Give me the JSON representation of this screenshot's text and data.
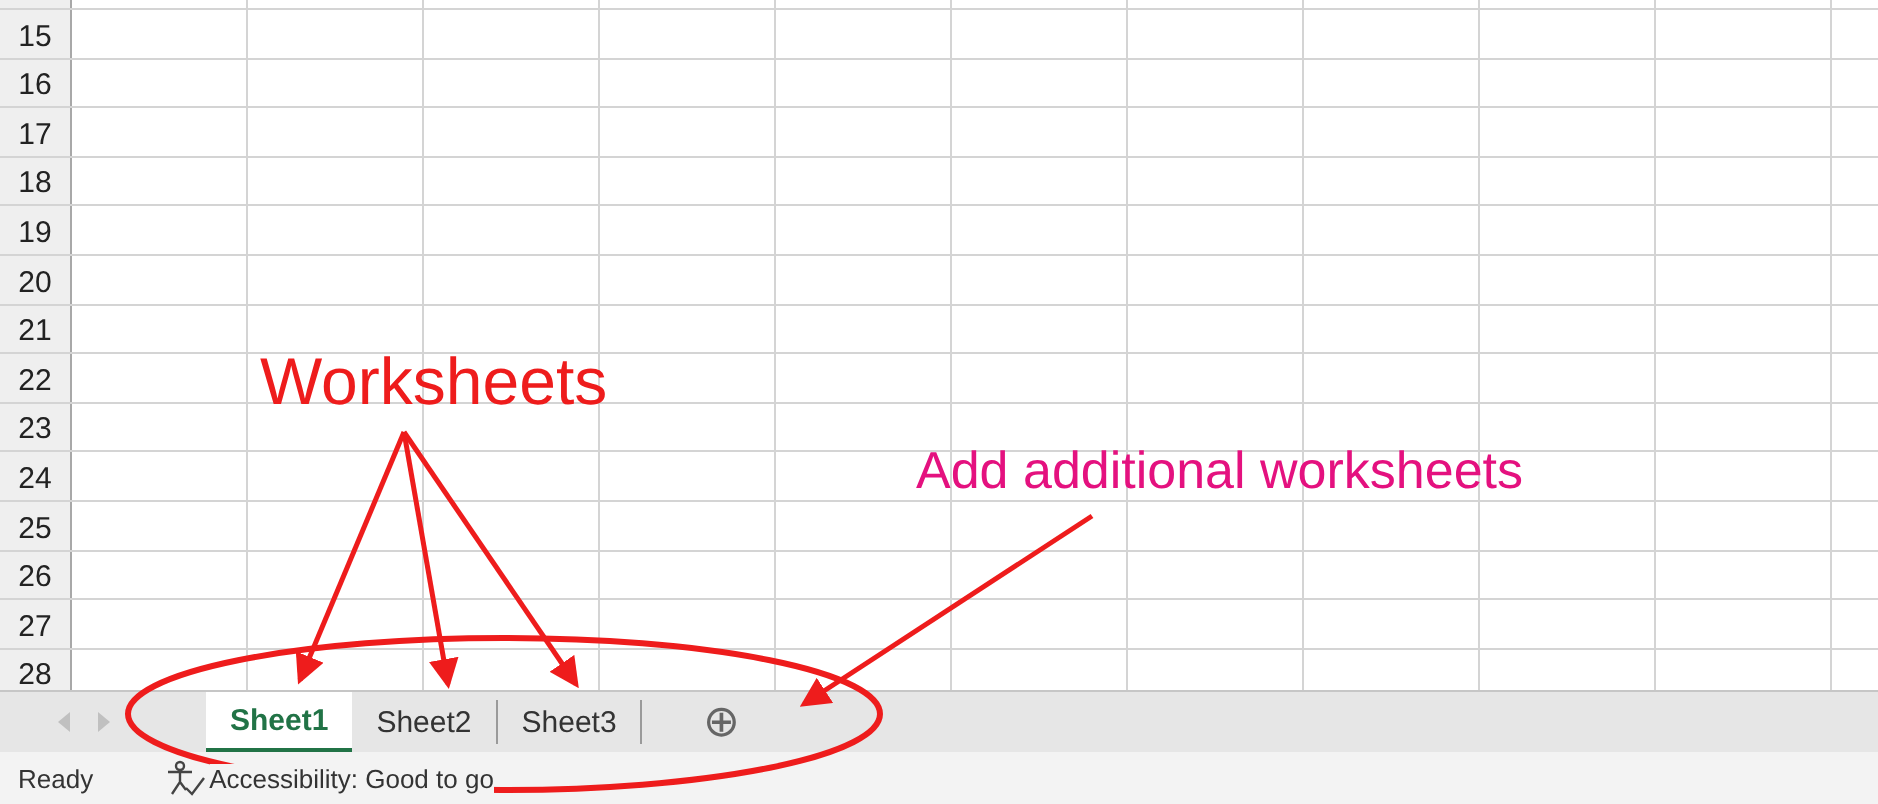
{
  "row_headers": [
    "15",
    "16",
    "17",
    "18",
    "19",
    "20",
    "21",
    "22",
    "23",
    "24",
    "25",
    "26",
    "27",
    "28"
  ],
  "sheet_nav": [
    {
      "kind": "left",
      "disabled": true
    },
    {
      "kind": "right",
      "disabled": true
    }
  ],
  "sheet_tabs": [
    {
      "label": "Sheet1",
      "selected": true
    },
    {
      "label": "Sheet2",
      "selected": false
    },
    {
      "label": "Sheet3",
      "selected": false
    }
  ],
  "add_sheet": {
    "icon": "⊕"
  },
  "status_bar": {
    "mode": "Ready",
    "accessibility": "Accessibility: Good to go"
  },
  "annotations": [
    {
      "kind": "title",
      "text": "Worksheets",
      "color": "#ee1c1c"
    },
    {
      "kind": "note",
      "text": "Add additional worksheets",
      "color": "#e4117f"
    }
  ]
}
